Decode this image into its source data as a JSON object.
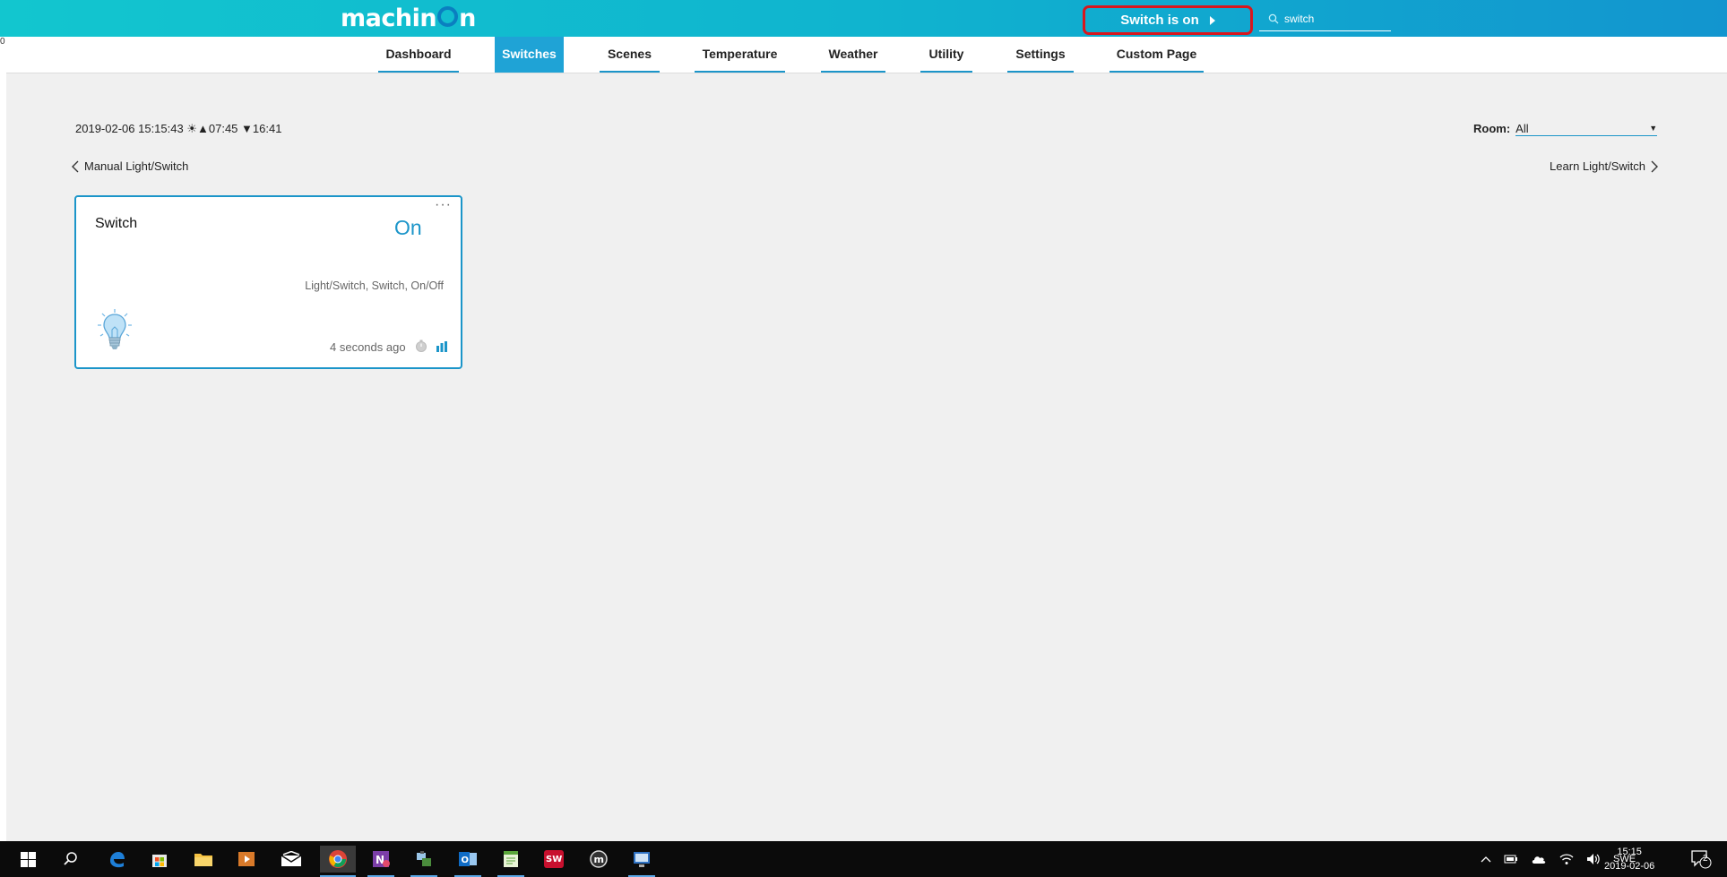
{
  "header": {
    "logo": "machinon",
    "notification": "Switch is on",
    "search_value": "switch"
  },
  "tabs": [
    {
      "label": "Dashboard"
    },
    {
      "label": "Switches"
    },
    {
      "label": "Scenes"
    },
    {
      "label": "Temperature"
    },
    {
      "label": "Weather"
    },
    {
      "label": "Utility"
    },
    {
      "label": "Settings"
    },
    {
      "label": "Custom Page"
    }
  ],
  "info": {
    "datetime": "2019-02-06 15:15:43",
    "sunrise": "▲07:45",
    "sunset": "▼16:41",
    "room_label": "Room:",
    "room_value": "All"
  },
  "nav": {
    "prev": "Manual Light/Switch",
    "next": "Learn Light/Switch"
  },
  "device": {
    "name": "Switch",
    "status": "On",
    "types": "Light/Switch, Switch, On/Off",
    "last_update": "4 seconds ago",
    "status_color": "#1b95c9"
  },
  "taskbar": {
    "language": "SWE",
    "time": "15:15",
    "date": "2019-02-06",
    "notification_count": "2"
  },
  "edge_marker": "0",
  "colors": {
    "accent": "#1b95c9",
    "highlight_border": "#d9161d"
  }
}
